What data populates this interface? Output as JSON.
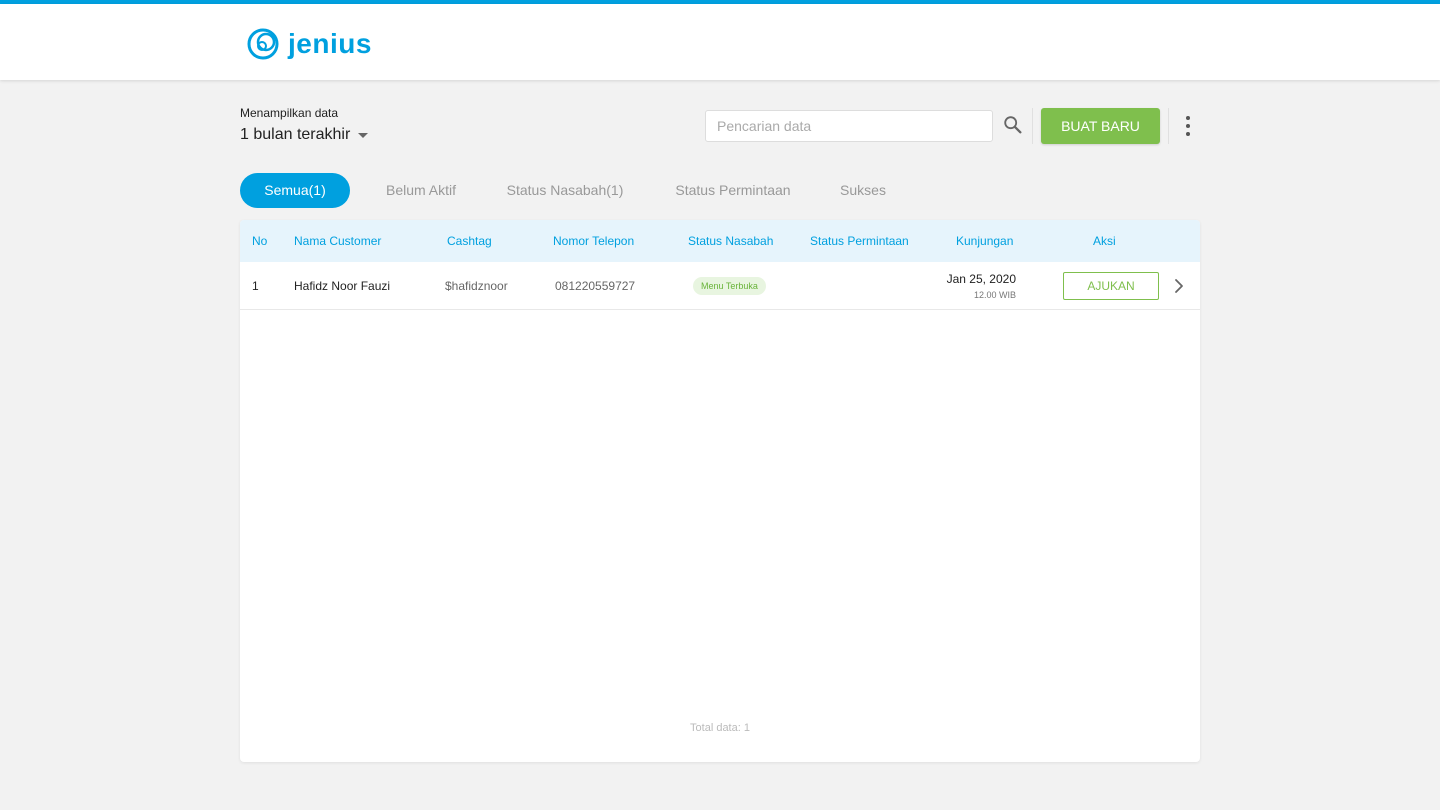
{
  "brand": {
    "name": "jenius",
    "logo_icon": "jenius-rings-logo",
    "accent_color": "#00a0df",
    "action_color": "#7fbf4d"
  },
  "filter": {
    "caption": "Menampilkan data",
    "selected": "1 bulan terakhir"
  },
  "search": {
    "placeholder": "Pencarian data",
    "icon": "search-icon"
  },
  "toolbar": {
    "create_label": "BUAT BARU",
    "more_icon": "more-vertical-icon"
  },
  "tabs": [
    {
      "label": "Semua(1)",
      "active": true
    },
    {
      "label": "Belum Aktif",
      "active": false
    },
    {
      "label": "Status Nasabah(1)",
      "active": false
    },
    {
      "label": "Status Permintaan",
      "active": false
    },
    {
      "label": "Sukses",
      "active": false
    }
  ],
  "table": {
    "columns": [
      "No",
      "Nama Customer",
      "Cashtag",
      "Nomor Telepon",
      "Status Nasabah",
      "Status Permintaan",
      "Kunjungan",
      "Aksi"
    ],
    "rows": [
      {
        "no": "1",
        "name": "Hafidz Noor Fauzi",
        "cashtag": "$hafidznoor",
        "phone": "081220559727",
        "status_nasabah": "Menu Terbuka",
        "status_permintaan": "",
        "visit_date": "Jan 25, 2020",
        "visit_time": "12.00 WIB",
        "action_label": "AJUKAN",
        "detail_icon": "chevron-right-icon"
      }
    ],
    "total_label": "Total data: 1"
  }
}
